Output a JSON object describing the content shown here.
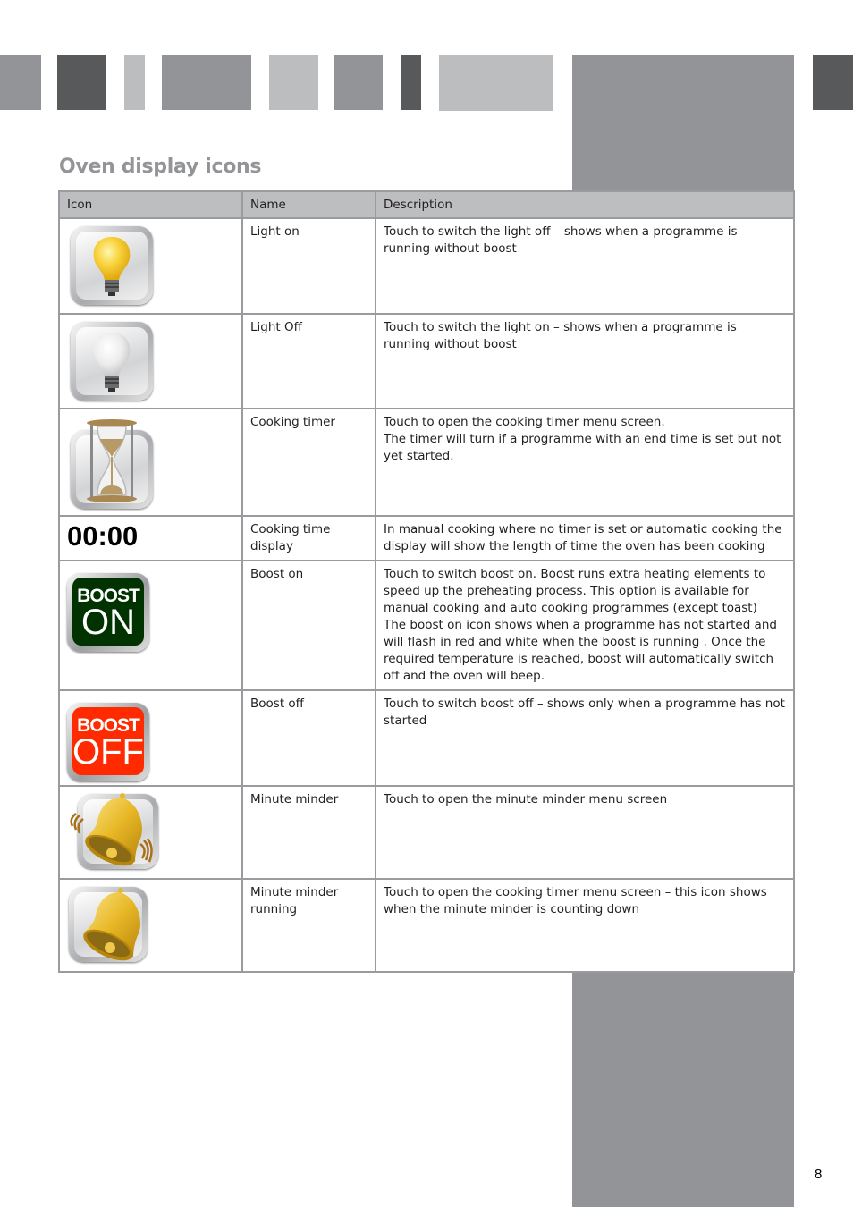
{
  "page": {
    "title": "Oven display icons",
    "page_number": "8"
  },
  "colors": {
    "mid_gray": "#939498",
    "dark_gray": "#58595b",
    "light_gray": "#bcbdbf",
    "boost_on_green": "#003300",
    "boost_off_red": "#ff2a00"
  },
  "table": {
    "headers": [
      "Icon",
      "Name",
      "Description"
    ],
    "rows": [
      {
        "icon": "light-bulb-on-icon",
        "name": "Light on",
        "description": "Touch to switch the light off  – shows when a programme is running without boost"
      },
      {
        "icon": "light-bulb-off-icon",
        "name": "Light Off",
        "description": "Touch to switch the light on  – shows when a programme is running without boost"
      },
      {
        "icon": "hourglass-icon",
        "name": "Cooking timer",
        "description": "Touch to open the cooking timer menu screen.\nThe timer will turn if a programme with an end time is set but not yet started."
      },
      {
        "icon": "time-display",
        "display_text": "00:00",
        "name": "Cooking time display",
        "description": "In manual cooking where no timer is set or automatic cooking the display will show the length of time the oven has been cooking"
      },
      {
        "icon": "boost-on-icon",
        "icon_line1": "BOOST",
        "icon_line2": "ON",
        "name": "Boost on",
        "description": "Touch to switch boost on.  Boost runs extra heating elements to speed up the preheating process.  This option is available for manual cooking and auto cooking programmes (except toast)\nThe boost on icon shows when a programme has not started and will flash in red and white when the boost is running .  Once the required temperature is reached, boost will automatically switch off and the oven will beep."
      },
      {
        "icon": "boost-off-icon",
        "icon_line1": "BOOST",
        "icon_line2": "OFF",
        "name": "Boost off",
        "description": "Touch to switch boost off – shows only when a programme has not started"
      },
      {
        "icon": "ringing-bell-icon",
        "name": "Minute minder",
        "description": "Touch to open the minute minder menu screen"
      },
      {
        "icon": "bell-icon",
        "name": "Minute minder running",
        "description": "Touch to open the cooking timer menu screen – this icon shows when the minute minder is counting down"
      }
    ]
  }
}
